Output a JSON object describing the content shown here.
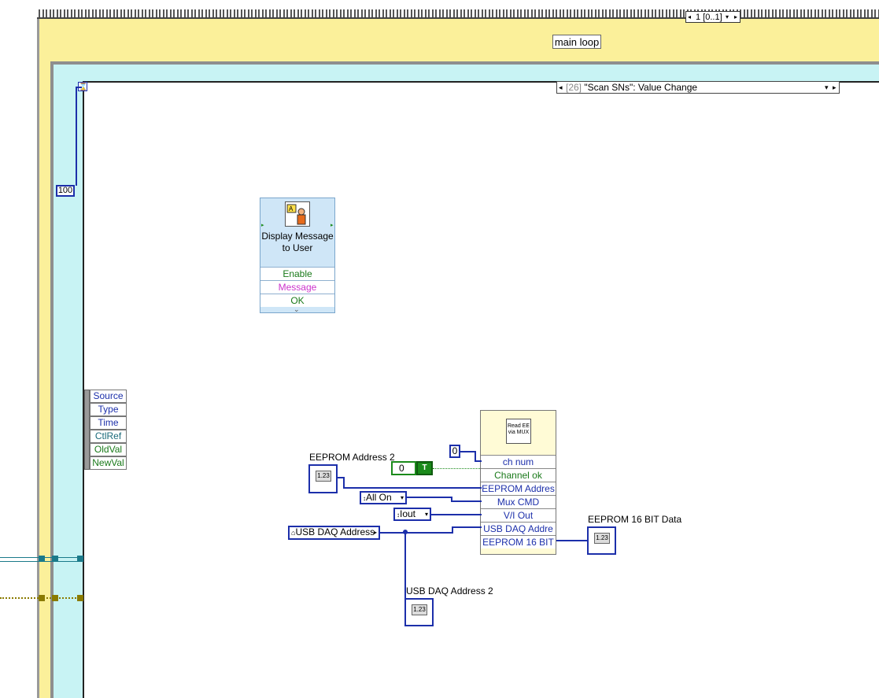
{
  "structure": {
    "case_selector": "1 [0..1]",
    "loop_label": "main loop",
    "event_selector_index": "[26]",
    "event_selector_text": "\"Scan SNs\": Value Change",
    "timeout_constant": "100"
  },
  "event_data_node": {
    "items": [
      "Source",
      "Type",
      "Time",
      "CtlRef",
      "OldVal",
      "NewVal"
    ]
  },
  "display_message": {
    "title": "Display Message to User",
    "terminals": [
      "Enable",
      "Message",
      "OK"
    ]
  },
  "read_ee": {
    "icon_text": "Read EE via MUX",
    "terminals": [
      "ch num",
      "Channel ok",
      "EEPROM Addres",
      "Mux CMD",
      "V/I Out",
      "USB DAQ Addre",
      "EEPROM 16 BIT"
    ]
  },
  "controls": {
    "eeprom_address_label": "EEPROM Address 2",
    "const_zero": "0",
    "bool_const": "0",
    "mux_enum": "All On",
    "vi_enum": "Iout",
    "usb_daq_ref": "USB DAQ Address",
    "indicator_numeric": "1.23",
    "eeprom_data_label": "EEPROM 16 BIT Data",
    "usb_daq_label": "USB DAQ Address 2"
  },
  "colors": {
    "case_bg": "#fbf09a",
    "loop_bg": "#c8f3f4",
    "wire_numeric": "#1c2faa",
    "wire_boolean": "#1a8a1a",
    "express_vi": "#cfe6f7",
    "subvi": "#fffbd6"
  }
}
